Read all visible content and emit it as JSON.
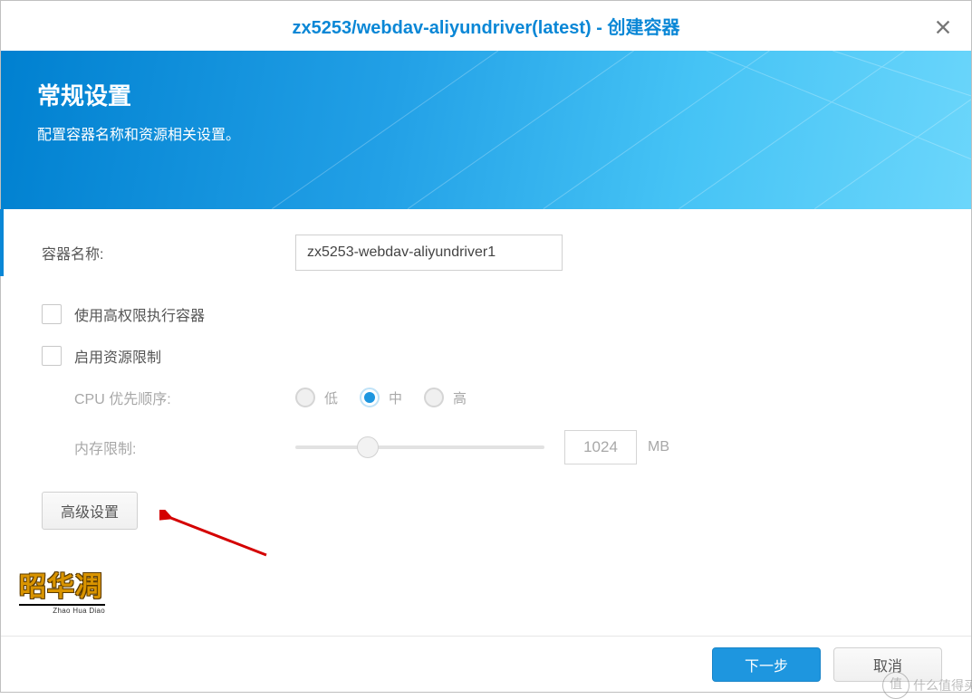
{
  "window": {
    "title": "zx5253/webdav-aliyundriver(latest) - 创建容器"
  },
  "banner": {
    "heading": "常规设置",
    "subheading": "配置容器名称和资源相关设置。"
  },
  "form": {
    "containerNameLabel": "容器名称:",
    "containerNameValue": "zx5253-webdav-aliyundriver1",
    "execHighPrivLabel": "使用高权限执行容器",
    "execHighPrivChecked": false,
    "enableResourceLimitLabel": "启用资源限制",
    "enableResourceLimitChecked": false,
    "cpuPriorityLabel": "CPU 优先顺序:",
    "cpuOptions": {
      "low": "低",
      "mid": "中",
      "high": "高"
    },
    "cpuSelected": "mid",
    "memoryLimitLabel": "内存限制:",
    "memoryValue": "1024",
    "memoryUnit": "MB",
    "advancedButton": "高级设置"
  },
  "footer": {
    "next": "下一步",
    "cancel": "取消"
  },
  "watermark": {
    "logoText": "昭华凋",
    "logoSub": "Zhao Hua Diao",
    "cornerChar": "值",
    "cornerText": "什么值得买"
  }
}
